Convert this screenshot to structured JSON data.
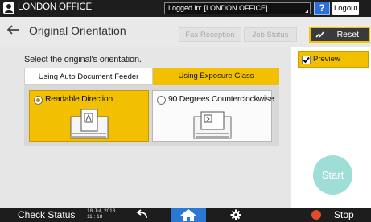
{
  "topbar": {
    "user_name": "LONDON OFFICE",
    "login_status": "Logged in: [LONDON OFFICE]",
    "help_label": "?",
    "logout_label": "Logout"
  },
  "header": {
    "title": "Original Orientation",
    "back_icon": "arrow-left-icon",
    "fax_reception_label": "Fax Reception",
    "job_status_label": "Job Status",
    "reset_label": "Reset"
  },
  "main": {
    "instruction": "Select the original's orientation.",
    "tabs": [
      {
        "label": "Using Auto Document Feeder",
        "selected": false
      },
      {
        "label": "Using Exposure Glass",
        "selected": true
      }
    ],
    "options": [
      {
        "label": "Readable Direction",
        "selected": true
      },
      {
        "label": "90 Degrees Counterclockwise",
        "selected": false
      }
    ]
  },
  "side": {
    "preview_label": "Preview",
    "preview_checked": true,
    "start_label": "Start"
  },
  "bottombar": {
    "check_status_label": "Check Status",
    "date": "18 Jul, 2018",
    "time": "11 : 18",
    "stop_label": "Stop"
  },
  "colors": {
    "accent_yellow": "#f2c000",
    "home_blue": "#2b78d4",
    "start_teal": "#9fded6",
    "stop_red": "#e04b2a"
  }
}
